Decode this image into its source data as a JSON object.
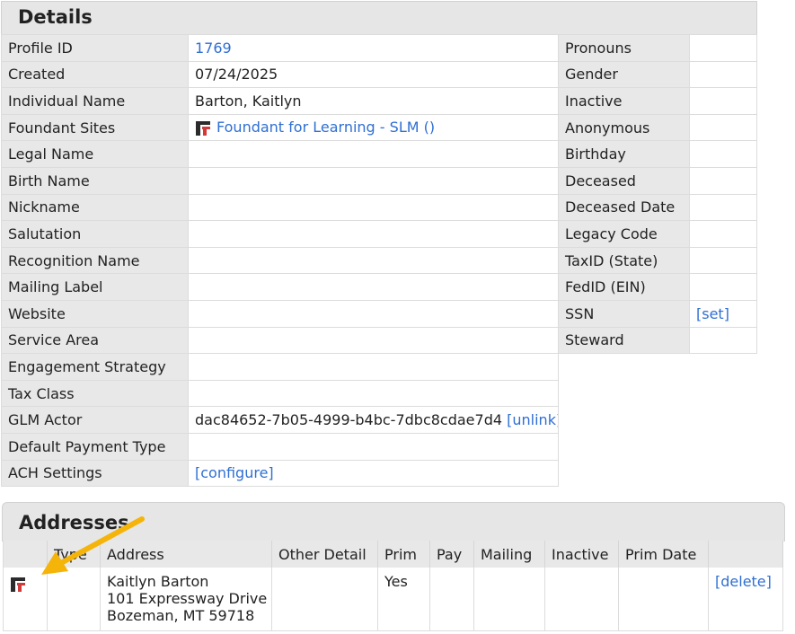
{
  "details": {
    "title": "Details",
    "left_rows": [
      {
        "label": "Profile ID",
        "value": "1769",
        "is_link": true
      },
      {
        "label": "Created",
        "value": "07/24/2025"
      },
      {
        "label": "Individual Name",
        "value": "Barton, Kaitlyn"
      },
      {
        "label": "Foundant Sites",
        "value": "Foundant for Learning - SLM ()",
        "is_link": true,
        "icon": "foundant-logo-icon"
      },
      {
        "label": "Legal Name",
        "value": ""
      },
      {
        "label": "Birth Name",
        "value": ""
      },
      {
        "label": "Nickname",
        "value": ""
      },
      {
        "label": "Salutation",
        "value": ""
      },
      {
        "label": "Recognition Name",
        "value": ""
      },
      {
        "label": "Mailing Label",
        "value": ""
      },
      {
        "label": "Website",
        "value": ""
      },
      {
        "label": "Service Area",
        "value": ""
      },
      {
        "label": "Engagement Strategy",
        "value": ""
      },
      {
        "label": "Tax Class",
        "value": ""
      },
      {
        "label": "GLM Actor",
        "value": "dac84652-7b05-4999-b4bc-7dbc8cdae7d4",
        "action": "[unlink]"
      },
      {
        "label": "Default Payment Type",
        "value": ""
      },
      {
        "label": "ACH Settings",
        "value": "[configure]",
        "is_link": true
      }
    ],
    "right_rows": [
      {
        "label": "Pronouns",
        "value": ""
      },
      {
        "label": "Gender",
        "value": ""
      },
      {
        "label": "Inactive",
        "value": ""
      },
      {
        "label": "Anonymous",
        "value": ""
      },
      {
        "label": "Birthday",
        "value": ""
      },
      {
        "label": "Deceased",
        "value": ""
      },
      {
        "label": "Deceased Date",
        "value": ""
      },
      {
        "label": "Legacy Code",
        "value": ""
      },
      {
        "label": "TaxID (State)",
        "value": ""
      },
      {
        "label": "FedID (EIN)",
        "value": ""
      },
      {
        "label": "SSN",
        "value": "[set]",
        "is_link": true
      },
      {
        "label": "Steward",
        "value": ""
      }
    ]
  },
  "addresses": {
    "title": "Addresses",
    "columns": [
      "",
      "Type",
      "Address",
      "Other Detail",
      "Prim",
      "Pay",
      "Mailing",
      "Inactive",
      "Prim Date",
      ""
    ],
    "rows": [
      {
        "icon": "foundant-logo-icon",
        "type": "",
        "address_lines": [
          "Kaitlyn Barton",
          "101 Expressway Drive",
          "Bozeman, MT 59718"
        ],
        "other_detail": "",
        "prim": "Yes",
        "pay": "",
        "mailing": "",
        "inactive": "",
        "prim_date": "",
        "action": "[delete]"
      }
    ]
  },
  "annotation": {
    "arrow_color": "#f5b40a"
  },
  "colors": {
    "link": "#2f6fd3",
    "header_bg": "#e6e6e6",
    "label_bg": "#e8e8e8"
  }
}
